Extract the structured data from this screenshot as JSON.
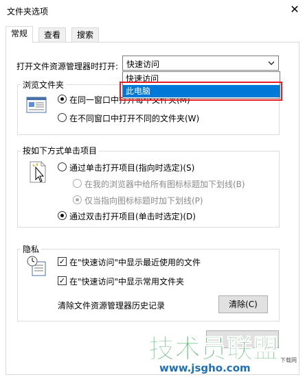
{
  "window": {
    "title": "文件夹选项",
    "close_glyph": "✕"
  },
  "tabs": [
    {
      "label": "常规",
      "active": true
    },
    {
      "label": "查看",
      "active": false
    },
    {
      "label": "搜索",
      "active": false
    }
  ],
  "open_explorer": {
    "label": "打开文件资源管理器时打开:",
    "selected": "快速访问",
    "options": [
      "快速访问",
      "此电脑"
    ],
    "highlighted": "此电脑"
  },
  "browse_folders": {
    "title": "浏览文件夹",
    "option_same_window": "在同一窗口中打开每个文件夹(M)",
    "option_new_window": "在不同窗口中打开不同的文件夹(W)"
  },
  "click_items": {
    "title": "按如下方式单击项目",
    "single_click": "通过单击打开项目(指向时选定)(S)",
    "underline_all": "在我的浏览器中给所有图标标题加下划线(B)",
    "underline_hover": "仅当指向图标标题时加下划线(P)",
    "double_click": "通过双击打开项目(单击时选定)(D)"
  },
  "privacy": {
    "title": "隐私",
    "show_recent_files": "在\"快速访问\"中显示最近使用的文件",
    "show_frequent_folders": "在\"快速访问\"中显示常用文件夹",
    "clear_history_label": "清除文件资源管理器历史记录",
    "clear_button": "清除(C)",
    "check_glyph": "✓"
  },
  "colors": {
    "selection": "#0078d7",
    "highlight_border": "#e51c23",
    "watermark_green": "#2fa84f",
    "watermark_blue": "#1f6fb5"
  },
  "watermark": {
    "text": "技术员联盟",
    "url": "www.jsgho.com",
    "corner_text": "下载网"
  }
}
